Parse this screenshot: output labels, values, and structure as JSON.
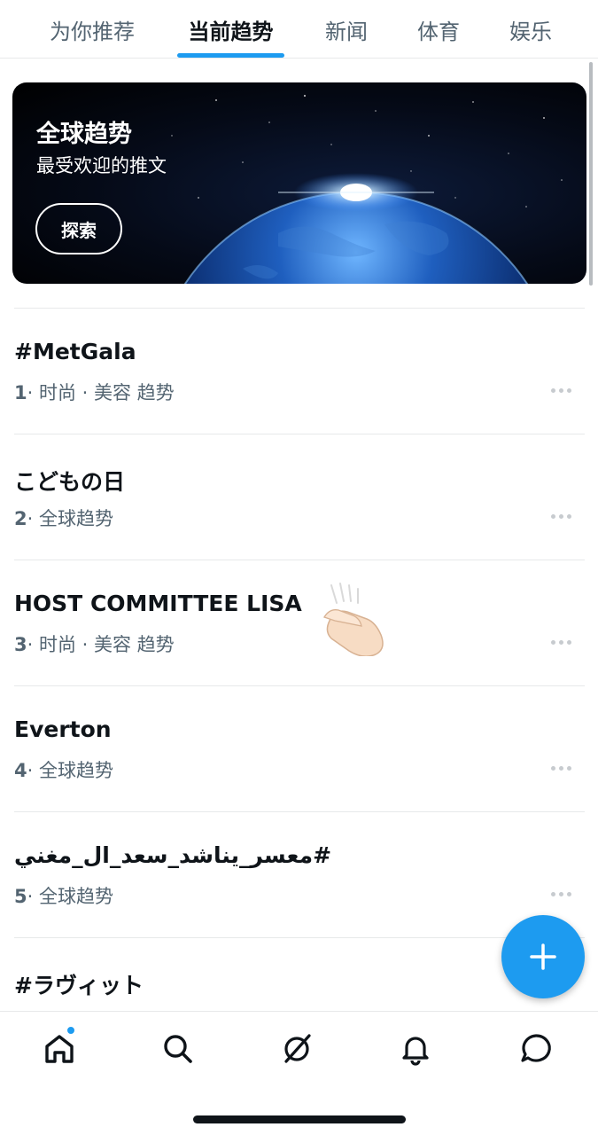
{
  "tabs": [
    {
      "label": "为你推荐",
      "active": false
    },
    {
      "label": "当前趋势",
      "active": true
    },
    {
      "label": "新闻",
      "active": false
    },
    {
      "label": "体育",
      "active": false
    },
    {
      "label": "娱乐",
      "active": false
    }
  ],
  "hero": {
    "title": "全球趋势",
    "subtitle": "最受欢迎的推文",
    "button_label": "探索"
  },
  "trends": [
    {
      "rank": "1",
      "name": "#MetGala",
      "category": "· 时尚 · 美容 趋势"
    },
    {
      "rank": "2",
      "name": "こどもの日",
      "category": "· 全球趋势"
    },
    {
      "rank": "3",
      "name": "HOST COMMITTEE LISA",
      "category": "· 时尚 · 美容 趋势"
    },
    {
      "rank": "4",
      "name": "Everton",
      "category": "· 全球趋势"
    },
    {
      "rank": "5",
      "name": "#معسر_يناشد_سعد_ال_مغني",
      "category": "· 全球趋势"
    },
    {
      "rank": "",
      "name": "#ラヴィット",
      "category": ""
    }
  ],
  "bottom_nav": [
    {
      "icon": "home-icon",
      "active": true,
      "has_badge": true
    },
    {
      "icon": "search-icon",
      "active": false
    },
    {
      "icon": "communities-icon",
      "active": false
    },
    {
      "icon": "bell-icon",
      "active": false
    },
    {
      "icon": "messages-icon",
      "active": false
    }
  ],
  "colors": {
    "accent": "#1d9bf0",
    "text_primary": "#0f1419",
    "text_secondary": "#536471",
    "divider": "#e7e9ea"
  }
}
